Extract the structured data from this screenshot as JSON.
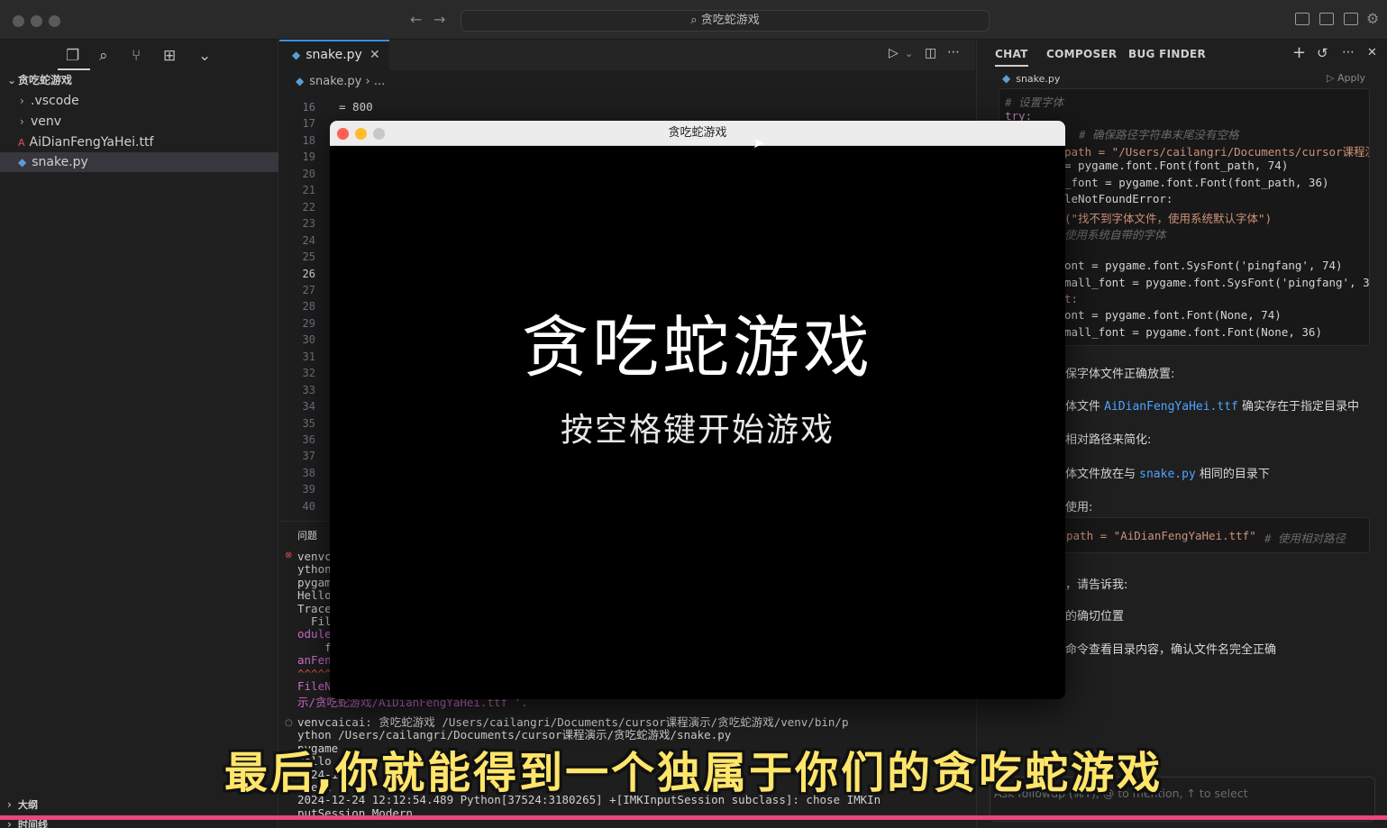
{
  "window": {
    "search_title": "贪吃蛇游戏"
  },
  "sidebar": {
    "root_label": "贪吃蛇游戏",
    "items": [
      {
        "label": ".vscode",
        "type": "folder"
      },
      {
        "label": "venv",
        "type": "folder"
      },
      {
        "label": "AiDianFengYaHei.ttf",
        "type": "font"
      },
      {
        "label": "snake.py",
        "type": "python",
        "selected": true
      }
    ],
    "outline_label": "大纲",
    "timeline_label": "时间线"
  },
  "editor": {
    "tab_label": "snake.py",
    "breadcrumb_file": "snake.py",
    "breadcrumb_more": "...",
    "line_numbers": [
      "16",
      "17",
      "18",
      "19",
      "20",
      "21",
      "22",
      "23",
      "24",
      "25",
      "26",
      "27",
      "28",
      "29",
      "30",
      "31",
      "32",
      "33",
      "34",
      "35",
      "36",
      "37",
      "38",
      "39",
      "40"
    ],
    "current_line": "26",
    "visible_code": "= 800"
  },
  "panel": {
    "problems_label": "问题",
    "lines_left": [
      "venvc",
      "ython",
      "pygam",
      "Hello",
      "Trace",
      "  Fil",
      "odule",
      "    f",
      "anFen",
      "^^^^^",
      "FileN"
    ],
    "path_line": "示/贪吃蛇游戏/AiDianFengYaHei.ttf '.",
    "terminal_lines": [
      "venvcaicai: 贪吃蛇游戏 /Users/cailangri/Documents/cursor课程演示/贪吃蛇游戏/venv/bin/p",
      "ython /Users/cailangri/Documents/cursor课程演示/贪吃蛇游戏/snake.py",
      "pygame",
      "Hello",
      "2024-12",
      "odern",
      "2024-12-24 12:12:54.489 Python[37524:3180265] +[IMKInputSession subclass]: chose IMKIn",
      "putSession_Modern"
    ]
  },
  "chat": {
    "tabs": [
      "CHAT",
      "COMPOSER",
      "BUG FINDER"
    ],
    "code_file": "snake.py",
    "apply_label": "Apply",
    "code_comment_font": "# 设置字体",
    "code_try": "try:",
    "code_comment_path": "# 确保路径字符串末尾没有空格",
    "code_path": "path = \"/Users/cailangri/Documents/cursor课程演",
    "code_font74": "= pygame.font.Font(font_path, 74)",
    "code_font36": "_font = pygame.font.Font(font_path, 36)",
    "code_except": "leNotFoundError:",
    "code_print": "(\"找不到字体文件，使用系统默认字体\")",
    "code_comment_sys": "使用系统自带的字体",
    "code_sys74": "ont = pygame.font.SysFont('pingfang', 74)",
    "code_sys36": "mall_font = pygame.font.SysFont('pingfang', 36",
    "code_colon": "t:",
    "code_none74": "ont = pygame.font.Font(None, 74)",
    "code_none36": "mall_font = pygame.font.Font(None, 36)",
    "text_1": "保字体文件正确放置:",
    "text_2a": "体文件",
    "text_2b": "AiDianFengYaHei.ttf",
    "text_2c": "确实存在于指定目录中",
    "text_3": "相对路径来简化:",
    "text_4a": "体文件放在与",
    "text_4b": "snake.py",
    "text_4c": "相同的目录下",
    "text_5": "使用:",
    "code_rel": "path = \"AiDianFengYaHei.ttf\"",
    "code_rel_comment": "# 使用相对路径",
    "text_6": "，请告诉我:",
    "text_7": "的确切位置",
    "text_8": "命令查看目录内容，确认文件名完全正确",
    "input_placeholder": "Ask followup (⌘Y), @ to mention, ↑ to select"
  },
  "game": {
    "window_title": "贪吃蛇游戏",
    "heading": "贪吃蛇游戏",
    "subheading": "按空格键开始游戏"
  },
  "subtitle": "最后,你就能得到一个独属于你们的贪吃蛇游戏"
}
